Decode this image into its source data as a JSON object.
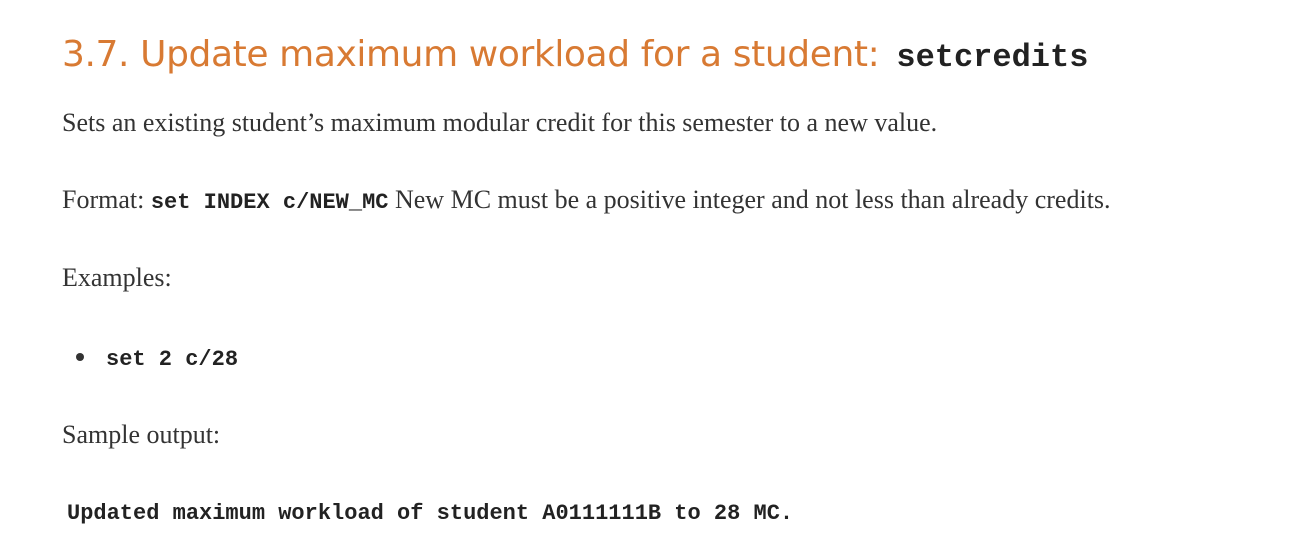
{
  "section": {
    "number": "3.7.",
    "title": "Update maximum workload for a student:",
    "command": "setcredits"
  },
  "description": "Sets an existing student’s maximum modular credit for this semester to a new value.",
  "format": {
    "label": "Format:",
    "syntax": "set INDEX c/NEW_MC",
    "note": "New MC must be a positive integer and not less than already credits."
  },
  "examples": {
    "label": "Examples:",
    "items": [
      "set 2 c/28"
    ]
  },
  "sample_output": {
    "label": "Sample output:",
    "text": "Updated maximum workload of student A0111111B to 28 MC."
  },
  "colors": {
    "heading": "#d87a33",
    "body_text": "#333333",
    "code": "#222222"
  }
}
